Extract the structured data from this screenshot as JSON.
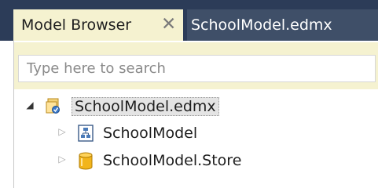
{
  "tabs": [
    {
      "label": "Model Browser",
      "active": true,
      "close_icon": "close-icon"
    },
    {
      "label": "SchoolModel.edmx",
      "active": false
    }
  ],
  "search": {
    "placeholder": "Type here to search",
    "value": ""
  },
  "tree": {
    "root": {
      "label": "SchoolModel.edmx",
      "expanded": true,
      "icon": "edmx-file-icon"
    },
    "children": [
      {
        "label": "SchoolModel",
        "expanded": false,
        "icon": "conceptual-model-icon"
      },
      {
        "label": "SchoolModel.Store",
        "expanded": false,
        "icon": "database-icon"
      }
    ]
  },
  "colors": {
    "tabbar_bg": "#2c3c58",
    "active_tab_bg": "#f5f2d0",
    "inactive_tab_bg": "#3f4f68"
  }
}
